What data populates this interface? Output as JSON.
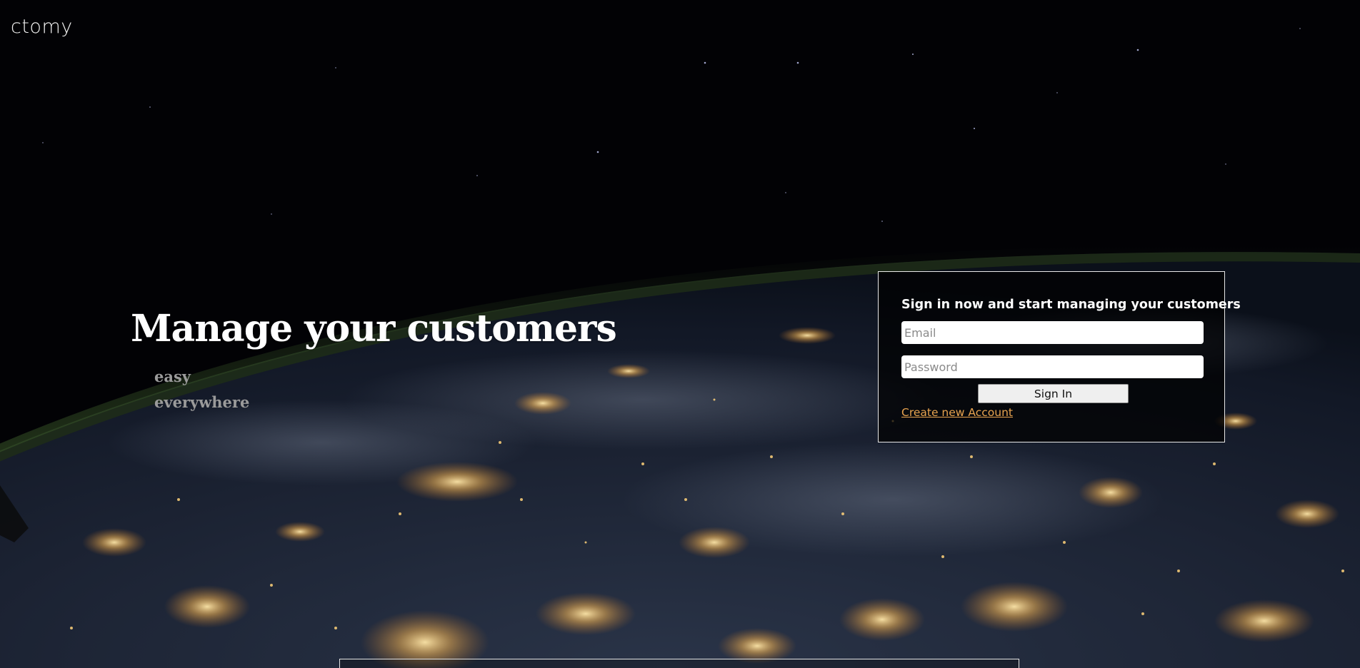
{
  "app": {
    "logo_text": "ctomy"
  },
  "hero": {
    "title": "Manage your customers",
    "subtitle_1": "easy",
    "subtitle_2": "everywhere"
  },
  "signin": {
    "heading": "Sign in now and start managing your customers",
    "email_placeholder": "Email",
    "email_value": "",
    "password_placeholder": "Password",
    "password_value": "",
    "submit_label": "Sign In",
    "create_account_label": "Create new Account"
  },
  "colors": {
    "link": "#e8a34f",
    "heading": "#ffffff",
    "subtitle": "#9a9a9a",
    "panel_border": "#e8e8e8"
  }
}
